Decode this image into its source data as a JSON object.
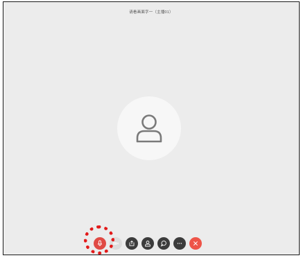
{
  "meeting": {
    "title": "请看画面字一（主播01）"
  },
  "participant": {
    "avatar_icon": "user-icon"
  },
  "toolbar": {
    "buttons": [
      {
        "name": "microphone",
        "icon": "microphone-icon",
        "color": "#e04a44",
        "highlighted": true
      },
      {
        "name": "video",
        "icon": "video-icon",
        "color": "#dcdcdc"
      },
      {
        "name": "share-screen",
        "icon": "share-screen-icon",
        "color": "#3c3c3c"
      },
      {
        "name": "participants",
        "icon": "person-icon",
        "color": "#3c3c3c"
      },
      {
        "name": "chat",
        "icon": "chat-bubble-icon",
        "color": "#3c3c3c"
      },
      {
        "name": "more",
        "icon": "ellipsis-icon",
        "color": "#3c3c3c"
      },
      {
        "name": "hang-up",
        "icon": "close-icon",
        "color": "#ee5448"
      }
    ]
  },
  "annotation": {
    "highlight_color": "#e21a1a"
  }
}
